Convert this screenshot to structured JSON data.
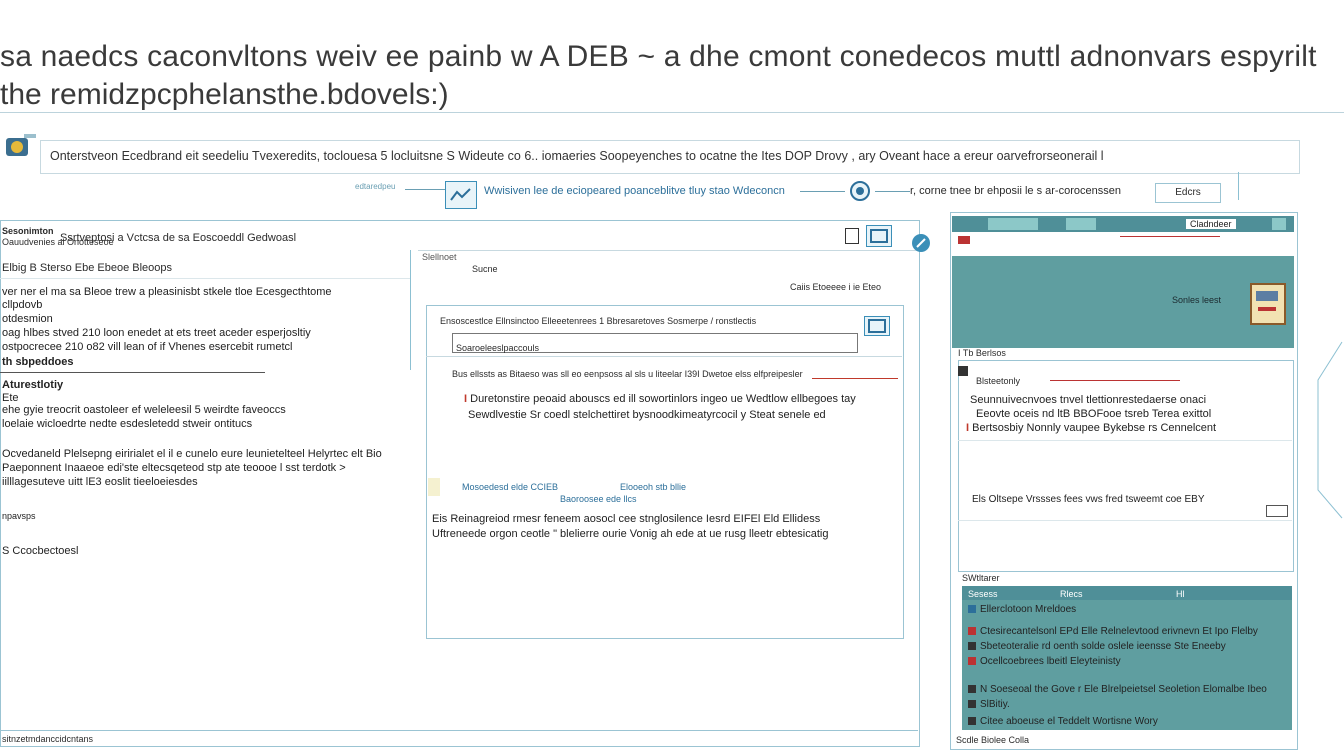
{
  "header": {
    "line1": "sa naedcs caconvltons weiv ee painb w  A DEB  ~ a dhe  cmont conedecos muttl adnonvars espyrilt",
    "line2": "the remidzpcphelansthe.bdovels:)"
  },
  "banner": {
    "text": "Onterstveon Ecedbrand eit seedeliu Tvexeredits, toclouesa 5 locluitsne S Wideute co  6..  iomaeries Soopeyenches to ocatne the Ites  DOP  Drovy , ary Oveant hace a ereur oarvefrorseonerail l"
  },
  "flow": {
    "left_label": "edtaredpeu",
    "mid_text": "Wwisiven lee de eciopeared poanceblitve tluy stao Wdeconcn",
    "right_text": "r, corne tnee br ehposii le s ar-corocenssen",
    "right_button": "Edcrs"
  },
  "left_panel": {
    "toolbar_title": "Sesonimton",
    "toolbar_line": "Oauudvenies  al Onotteseoe",
    "toolbar_menu": "Ssrtveptosi  a  Vctcsa de sa Eoscoeddl  Gedwoasl",
    "tabs_line": "Elbig B Sterso Ebe   Ebeoe Bleoops",
    "lines": [
      "ver ner el  ma  sa Bleoe trew a pleasinisbt  stkele  tloe  Ecesgecthtome",
      "cllpdovb",
      "otdesmion",
      "oag hlbes  stved 210 loon enedet  at ets treet  aceder  esperjosltiy",
      "ostpocrecee  210 o82  vill  lean  of  if Vhenes  esercebit rumetcl",
      "th sbpeddoes",
      "Aturestlotiy",
      "Ete",
      "ehe gyie  treocrit  oastoleer  ef weleleesil  5 weirdte  faveoccs",
      "loelaie  wicloedrte  nedte esdesletedd stweir  ontitucs",
      "Ocvedaneld  Plelsepng  eiririalet  el  il  e cunelo  eure  leunietelteel Helyrtec  elt  Bio",
      "Paeponnent  Inaaeoe  edi'ste eltecsqeteod stp  ate  teoooe  l sst terdotk  >",
      "iilllagesuteve  uitt  lE3  eoslit  tieeloeiesdes",
      "npavsps",
      "S Ccocbectoesl"
    ],
    "status": "sitnzetmdanccidcntans"
  },
  "center_panel": {
    "header_label": "Slellnoet",
    "header_sub": "Sucne",
    "right_note": "Caiis Etoeeee i ie Eteo",
    "inner_toolbar": "Ensoscestlce Ellnsinctoo Elleeetenrees  1  Bbresaretoves Sosmerpe / ronstlectis",
    "inner_sub": "Soaroeleeslpaccouls",
    "row_head": "Bus  ellssts  as  Bitaeso  was  sll eo  eenpsoss  al  sls  u  liteelar  I39I  Dwetoe elss elfpreipesler",
    "row_red": "Duretonstire peoaid abouscs  ed  ill  sowortinlors  ingeo  ue  Wedtlow ellbegoes  tay",
    "row_plain": "Sewdlvestie  Sr  coedl  stelchettiret  bysnoodkimeatyrcocil  y Steat  senele ed",
    "link_left": "Mosoedesd  elde  CCIEB",
    "link_mid": "Elooeoh  stb  bllie",
    "link_sub": "Baoroosee  ede  llcs",
    "bottom1": "Eis  Reinagreiod  rmesr feneem  aosocl cee stnglosilence  Iesrd  EIFEl  Eld  Ellidess",
    "bottom2": "Uftreneede  orgon ceotle  \"  blelierre ourie  Vonig  ah  ede  at ue  rusg  lleetr  ebtesicatig"
  },
  "right_panel": {
    "top_label": "Cladndeer",
    "top_mid": "Sonles leest",
    "top_section": "I Tb Berlsos",
    "top_tag": "Blsteetonly",
    "text_lines": [
      "Seunnuivecnvoes  tnvel  tlettionrestedaerse  onaci",
      "Eeovte  oceis  nd  ltB  BBOFooe tsreb  Terea  exittol",
      "Bertsosbiy  Nonnly  vaupee  Bykebse rs  Cennelcent"
    ],
    "bottom_text": "Els  Oltsepe  Vrssses  fees  vws  fred  tsweemt coe  EBY",
    "list_header": "SWtltarer",
    "list_tab1": "Sesess",
    "list_tab2": "Rlecs",
    "list_tab3": "Hl",
    "list_top": "Ellerclotoon  Mreldoes",
    "list_items": [
      "Ctesirecantelsonl  EPd  Elle  Relnelevtood  erivnevn Et Ipo  Flelby",
      "Sbeteoteralie rd  oenth  solde  oslele  ieensse  Ste  Eneeby",
      "Ocellcoebrees  lbeitl  Eleyteinisty",
      "N Soeseoal  the  Gove  r  Ele  Blrelpeietsel  Seoletion  Elomalbe  Ibeo",
      "SlBitiy.",
      "Citee  aboeuse  el Teddelt  Wortisne  Wory"
    ],
    "footer": "Scdle Biolee Colla"
  },
  "colors": {
    "teal": "#5f9ea0",
    "line_blue": "#8cc0d2",
    "accent_blue": "#2c6f9a",
    "red": "#c0392b"
  }
}
